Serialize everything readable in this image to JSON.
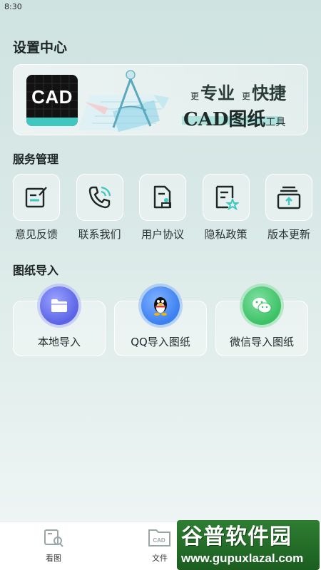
{
  "status_bar": {
    "time": "8:30"
  },
  "page": {
    "title": "设置中心"
  },
  "banner": {
    "logo_text": "CAD",
    "slogan_small_1": "更",
    "slogan_big_1": "专业",
    "slogan_small_2": "更",
    "slogan_big_2": "快捷",
    "line2_big": "CAD图纸",
    "line2_small": "工具"
  },
  "services": {
    "title": "服务管理",
    "items": [
      {
        "label": "意见反馈",
        "icon": "feedback-edit-icon"
      },
      {
        "label": "联系我们",
        "icon": "phone-icon"
      },
      {
        "label": "用户协议",
        "icon": "agreement-document-icon"
      },
      {
        "label": "隐私政策",
        "icon": "privacy-star-icon"
      },
      {
        "label": "版本更新",
        "icon": "version-update-icon"
      }
    ]
  },
  "imports": {
    "title": "图纸导入",
    "items": [
      {
        "label": "本地导入",
        "icon": "folder-icon",
        "color": "#5b63e6"
      },
      {
        "label": "QQ导入图纸",
        "icon": "qq-penguin-icon",
        "color": "#3b7ff0"
      },
      {
        "label": "微信导入图纸",
        "icon": "wechat-icon",
        "color": "#3cc166"
      }
    ]
  },
  "bottom_nav": {
    "items": [
      {
        "label": "看图",
        "icon": "view-drawing-icon"
      },
      {
        "label": "文件",
        "icon": "cad-file-icon"
      }
    ]
  },
  "watermark": {
    "text_cn": "谷普软件园",
    "url": "www.gupuxlazal.com"
  },
  "colors": {
    "accent": "#3fc7c0",
    "background": "#d8e8e6"
  }
}
